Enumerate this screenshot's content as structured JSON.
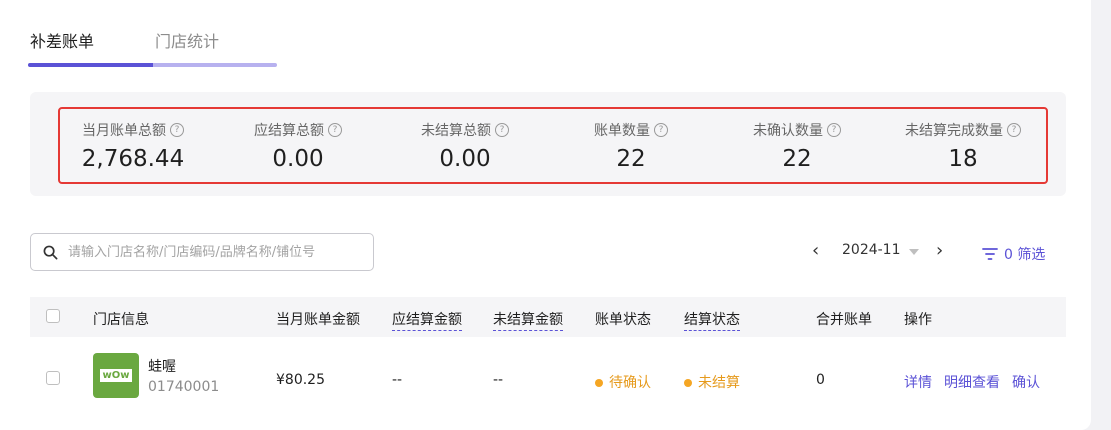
{
  "tabs": [
    {
      "label": "补差账单",
      "active": true
    },
    {
      "label": "门店统计",
      "active": false
    }
  ],
  "stats": [
    {
      "label": "当月账单总额",
      "value": "2,768.44"
    },
    {
      "label": "应结算总额",
      "value": "0.00"
    },
    {
      "label": "未结算总额",
      "value": "0.00"
    },
    {
      "label": "账单数量",
      "value": "22"
    },
    {
      "label": "未确认数量",
      "value": "22"
    },
    {
      "label": "未结算完成数量",
      "value": "18"
    }
  ],
  "help_icon": "question-circle-icon",
  "search": {
    "placeholder": "请输入门店名称/门店编码/品牌名称/铺位号",
    "value": ""
  },
  "month": {
    "value": "2024-11",
    "prev": "‹",
    "next": "›"
  },
  "filter": {
    "label": "0 筛选"
  },
  "table": {
    "headers": [
      "门店信息",
      "当月账单金额",
      "应结算金额",
      "未结算金额",
      "账单状态",
      "结算状态",
      "合并账单",
      "操作"
    ],
    "rows": [
      {
        "logo_text": "wOw",
        "store_name": "蛙喔",
        "store_code": "01740001",
        "monthly_amount": "¥80.25",
        "payable": "--",
        "unsettled": "--",
        "bill_status": "待确认",
        "settle_status": "未结算",
        "merged": "0",
        "actions": [
          "详情",
          "明细查看",
          "确认"
        ]
      }
    ]
  },
  "colors": {
    "accent": "#5b52d6",
    "warning": "#f5a623",
    "highlight": "#e53935"
  }
}
